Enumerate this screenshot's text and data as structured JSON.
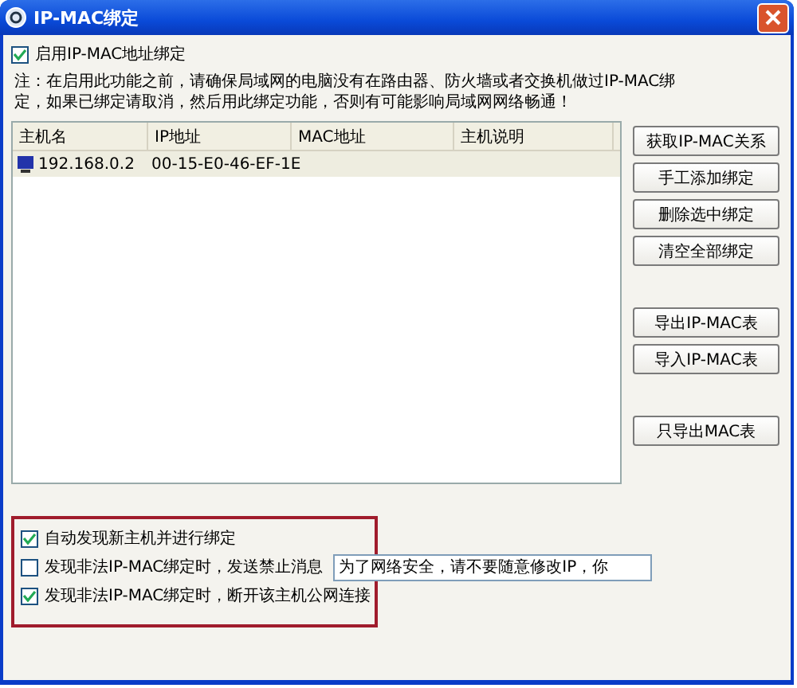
{
  "window": {
    "title": "IP-MAC绑定"
  },
  "enable": {
    "label": "启用IP-MAC地址绑定",
    "checked": true
  },
  "note": [
    "注：在启用此功能之前，请确保局域网的电脑没有在路由器、防火墙或者交换机做过IP-MAC绑",
    "定，如果已绑定请取消，然后用此绑定功能，否则有可能影响局域网网络畅通！"
  ],
  "table": {
    "columns": [
      "主机名",
      "IP地址",
      "MAC地址",
      "主机说明"
    ],
    "rows": [
      {
        "cells": [
          "192.168.0.2",
          "00-15-E0-46-EF-1E"
        ],
        "selected": true
      }
    ]
  },
  "button_groups": [
    [
      "获取IP-MAC关系",
      "手工添加绑定",
      "删除选中绑定",
      "清空全部绑定"
    ],
    [
      "导出IP-MAC表",
      "导入IP-MAC表"
    ],
    [
      "只导出MAC表"
    ]
  ],
  "options": [
    {
      "label": "自动发现新主机并进行绑定",
      "checked": true
    },
    {
      "label": "发现非法IP-MAC绑定时，发送禁止消息",
      "checked": false,
      "message": "为了网络安全，请不要随意修改IP，你"
    },
    {
      "label": "发现非法IP-MAC绑定时，断开该主机公网连接",
      "checked": true
    }
  ]
}
